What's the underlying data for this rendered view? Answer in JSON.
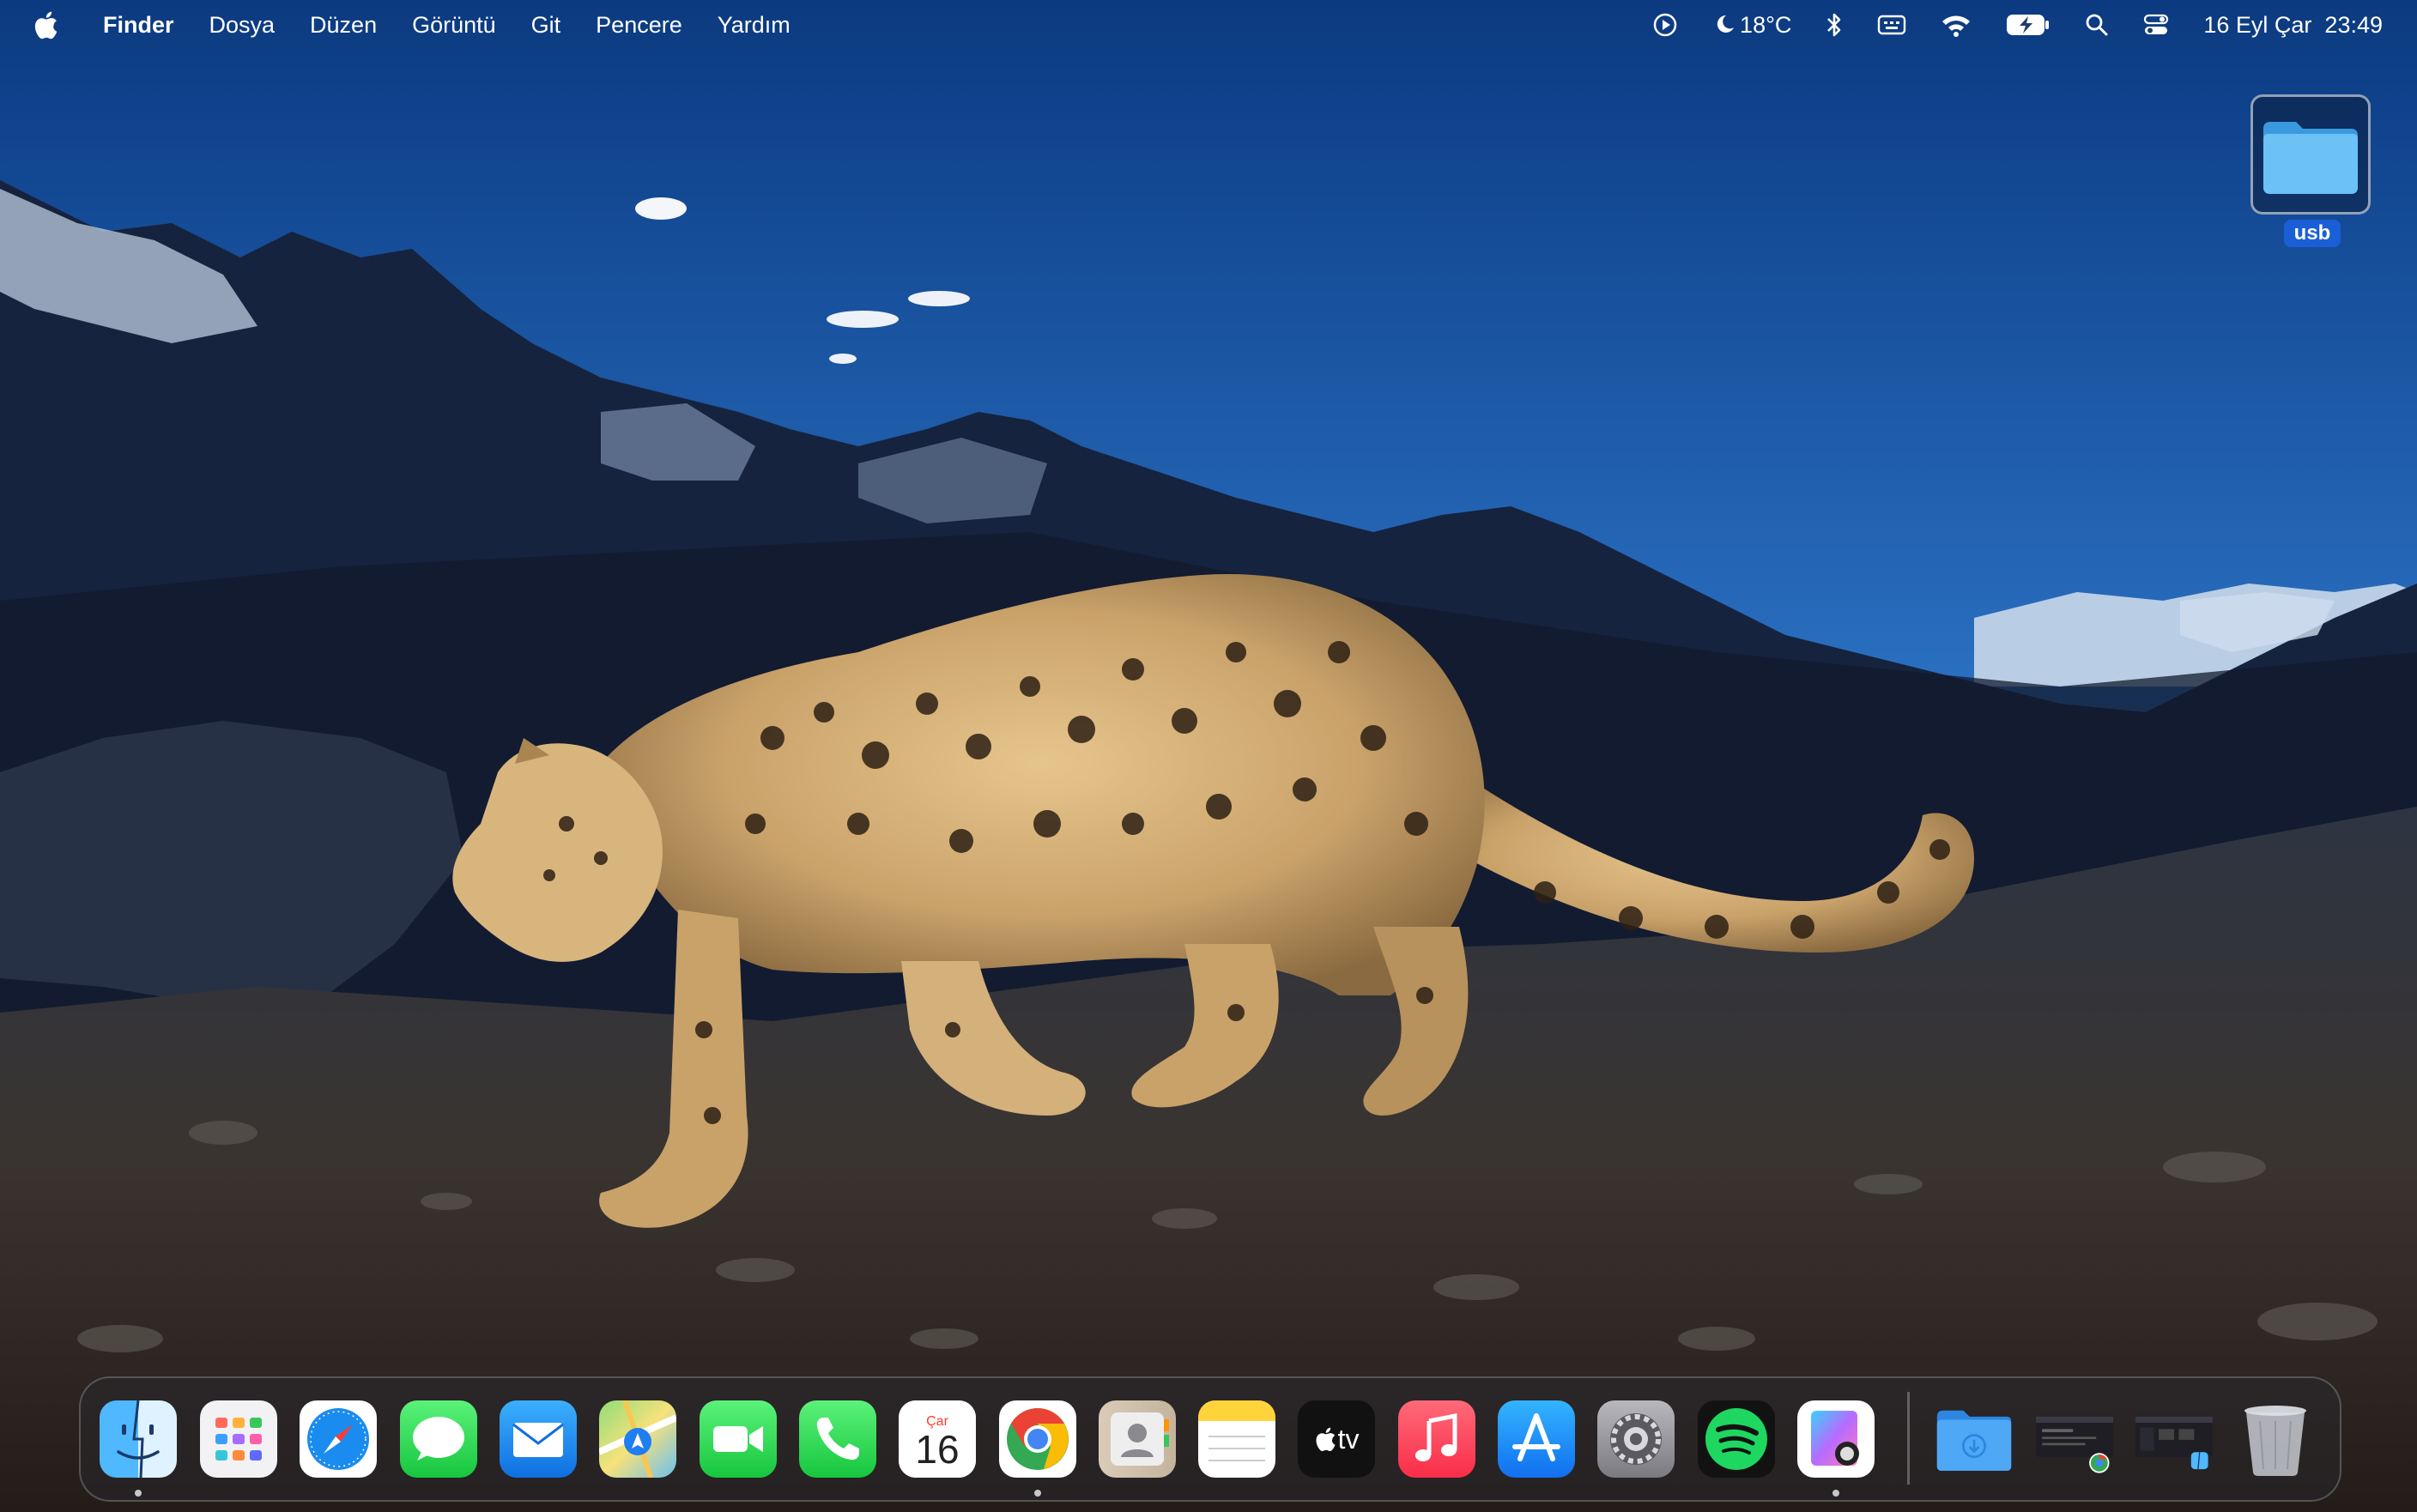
{
  "menubar": {
    "app_name": "Finder",
    "menus": [
      "Dosya",
      "Düzen",
      "Görüntü",
      "Git",
      "Pencere",
      "Yardım"
    ],
    "status": {
      "weather": "18°C",
      "datetime": "16 Eyl Çar  23:49"
    }
  },
  "desktop": {
    "items": [
      {
        "label": "usb",
        "icon": "folder-icon"
      }
    ]
  },
  "dock": {
    "apps": [
      {
        "name": "finder",
        "icon": "finder-icon",
        "running": true
      },
      {
        "name": "launchpad",
        "icon": "launchpad-icon",
        "running": false
      },
      {
        "name": "safari",
        "icon": "safari-icon",
        "running": false
      },
      {
        "name": "messages",
        "icon": "messages-icon",
        "running": false
      },
      {
        "name": "mail",
        "icon": "mail-icon",
        "running": false
      },
      {
        "name": "maps",
        "icon": "maps-icon",
        "running": false
      },
      {
        "name": "facetime",
        "icon": "facetime-icon",
        "running": false
      },
      {
        "name": "phone",
        "icon": "phone-icon",
        "running": false
      },
      {
        "name": "calendar",
        "icon": "calendar-icon",
        "running": false
      },
      {
        "name": "chrome",
        "icon": "chrome-icon",
        "running": true
      },
      {
        "name": "contacts",
        "icon": "contacts-icon",
        "running": false
      },
      {
        "name": "notes",
        "icon": "notes-icon",
        "running": false
      },
      {
        "name": "apple-tv",
        "icon": "apple-tv-icon",
        "running": false
      },
      {
        "name": "music",
        "icon": "music-icon",
        "running": false
      },
      {
        "name": "app-store",
        "icon": "app-store-icon",
        "running": false
      },
      {
        "name": "system-settings",
        "icon": "gear-icon",
        "running": false
      },
      {
        "name": "spotify",
        "icon": "spotify-icon",
        "running": false
      },
      {
        "name": "preview",
        "icon": "preview-icon",
        "running": true
      }
    ],
    "calendar": {
      "month": "Çar",
      "day": "16"
    },
    "apple_tv_label": "tv",
    "right": [
      "downloads-folder-icon",
      "chrome-window-thumbnail",
      "finder-window-thumbnail",
      "trash-icon"
    ]
  },
  "colors": {
    "accent": "#1b5fd6",
    "sky_top": "#0b3f8a",
    "sky_bottom": "#4a8fd6"
  }
}
